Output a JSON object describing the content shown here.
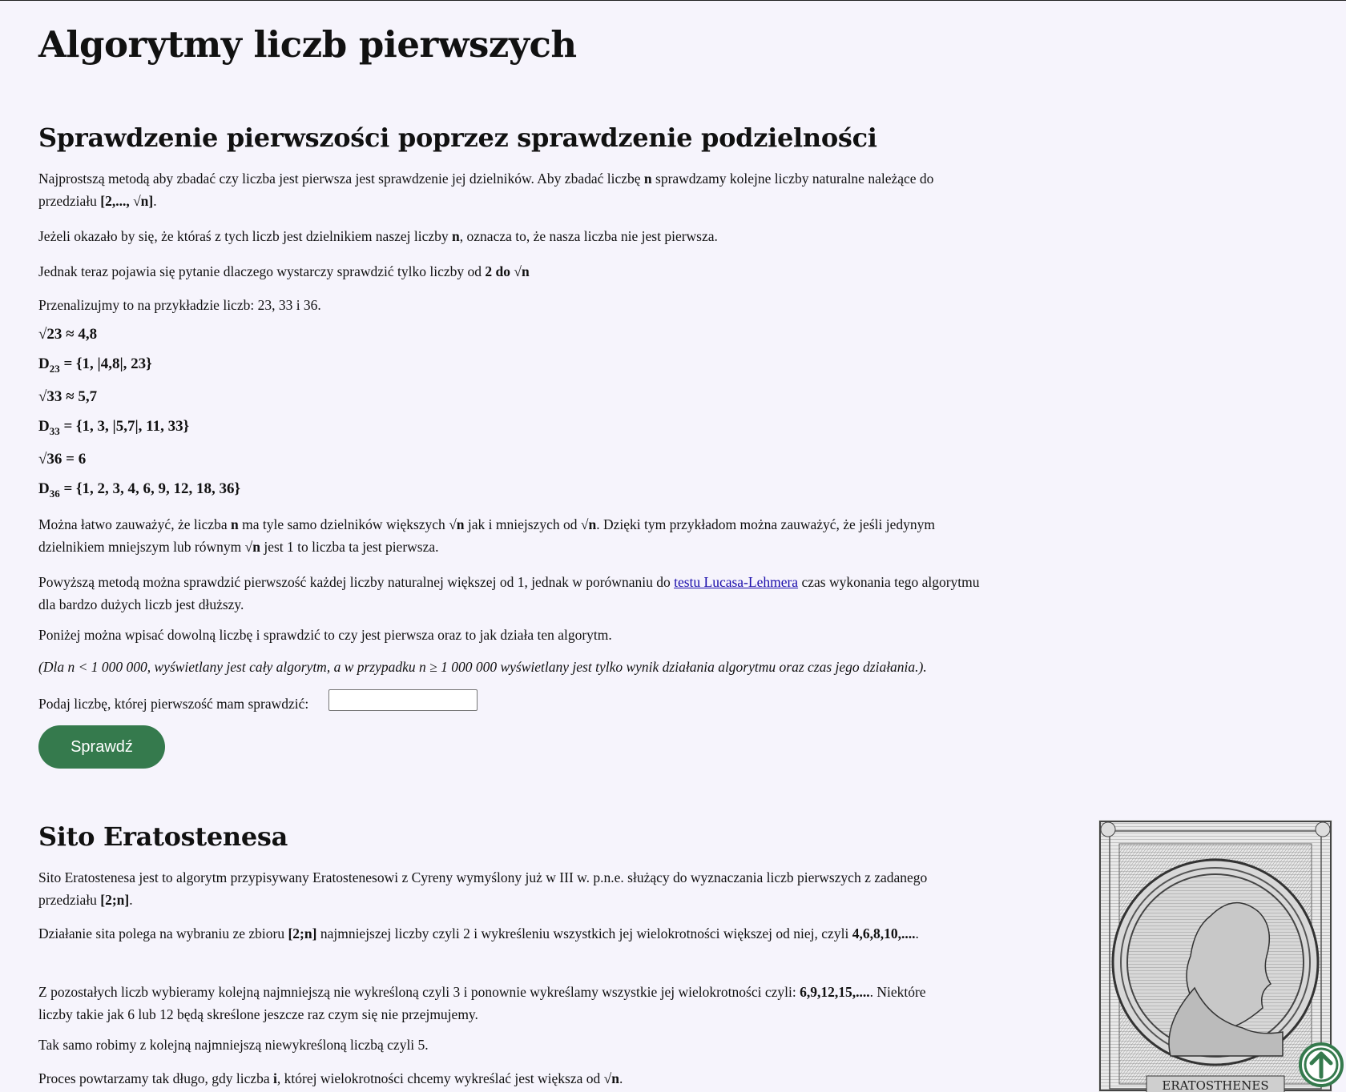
{
  "page_title": "Algorytmy liczb pierwszych",
  "section1": {
    "heading": "Sprawdzenie pierwszości poprzez sprawdzenie podzielności",
    "p1a": "Najprostszą metodą aby zbadać czy liczba jest pierwsza jest sprawdzenie jej dzielników. Aby zbadać liczbę ",
    "p1b": "n",
    "p1c": " sprawdzamy kolejne liczby naturalne należące do przedziału ",
    "p1d": "[2,..., √n]",
    "p1e": ".",
    "p2a": "Jeżeli okazało by się, że któraś z tych liczb jest dzielnikiem naszej liczby ",
    "p2b": "n",
    "p2c": ", oznacza to, że nasza liczba nie jest pierwsza.",
    "p3a": "Jednak teraz pojawia się pytanie dlaczego wystarczy sprawdzić tylko liczby od ",
    "p3b": "2 do √n",
    "p4": "Przenalizujmy to na przykładzie liczb: 23, 33 i 36.",
    "f1": "√23 ≈ 4,8",
    "f2_base": "D",
    "f2_sub": "23",
    "f2_rest": " = {1, |4,8|, 23}",
    "f3": "√33 ≈ 5,7",
    "f4_base": "D",
    "f4_sub": "33",
    "f4_rest": " = {1, 3, |5,7|, 11, 33}",
    "f5": "√36 = 6",
    "f6_base": "D",
    "f6_sub": "36",
    "f6_rest": " = {1, 2, 3, 4, 6, 9, 12, 18, 36}",
    "p5a": "Można łatwo zauważyć, że liczba ",
    "p5b": "n",
    "p5c": " ma tyle samo dzielników większych ",
    "p5d": "√n",
    "p5e": " jak i mniejszych od ",
    "p5f": "√n",
    "p5g": ". Dzięki tym przykładom można zauważyć, że jeśli jedynym dzielnikiem mniejszym lub równym ",
    "p5h": "√n",
    "p5i": " jest 1 to liczba ta jest pierwsza.",
    "p6a": "Powyższą metodą można sprawdzić pierwszość każdej liczby naturalnej większej od 1, jednak w porównaniu do ",
    "p6_link": "testu Lucasa-Lehmera",
    "p6b": " czas wykonania tego algorytmu dla bardzo dużych liczb jest dłuższy.",
    "p7": "Poniżej można wpisać dowolną liczbę i sprawdzić to czy jest pierwsza oraz to jak działa ten algorytm.",
    "p8": "(Dla n < 1 000 000, wyświetlany jest cały algorytm, a w przypadku n ≥ 1 000 000 wyświetlany jest tylko wynik działania algorytmu oraz czas jego działania.).",
    "input_label": "Podaj liczbę, której pierwszość mam sprawdzić:",
    "input_value": "",
    "button_label": "Sprawdź"
  },
  "section2": {
    "heading": "Sito Eratostenesa",
    "p1a": "Sito Eratostenesa jest to algorytm przypisywany Eratostenesowi z Cyreny wymyślony już w III w. p.n.e. służący do wyznaczania liczb pierwszych z zadanego przedziału ",
    "p1b": "[2;n]",
    "p1c": ".",
    "p2a": "Działanie sita polega na wybraniu ze zbioru ",
    "p2b": "[2;n]",
    "p2c": " najmniejszej liczby czyli 2 i wykreśleniu wszystkich jej wielokrotności większej od niej, czyli ",
    "p2d": "4,6,8,10,....",
    "p2e": ".",
    "p3a": "Z pozostałych liczb wybieramy kolejną najmniejszą nie wykreśloną czyli 3 i ponownie wykreślamy wszystkie jej wielokrotności czyli: ",
    "p3b": "6,9,12,15,....",
    "p3c": ". Niektóre liczby takie jak 6 lub 12 będą skreślone jeszcze raz czym się nie przejmujemy.",
    "p4": "Tak samo robimy z kolejną najmniejszą niewykreśloną liczbą czyli 5.",
    "p5a": "Proces powtarzamy tak długo, gdy liczba ",
    "p5b": "i",
    "p5c": ", której wielokrotności chcemy wykreślać jest większa od ",
    "p5d": "√n",
    "p5e": ".",
    "portrait_caption": "ERATOSTHENES"
  },
  "icons": {
    "to_top": "arrow-up-circle-icon",
    "accent": "#357a4d"
  }
}
